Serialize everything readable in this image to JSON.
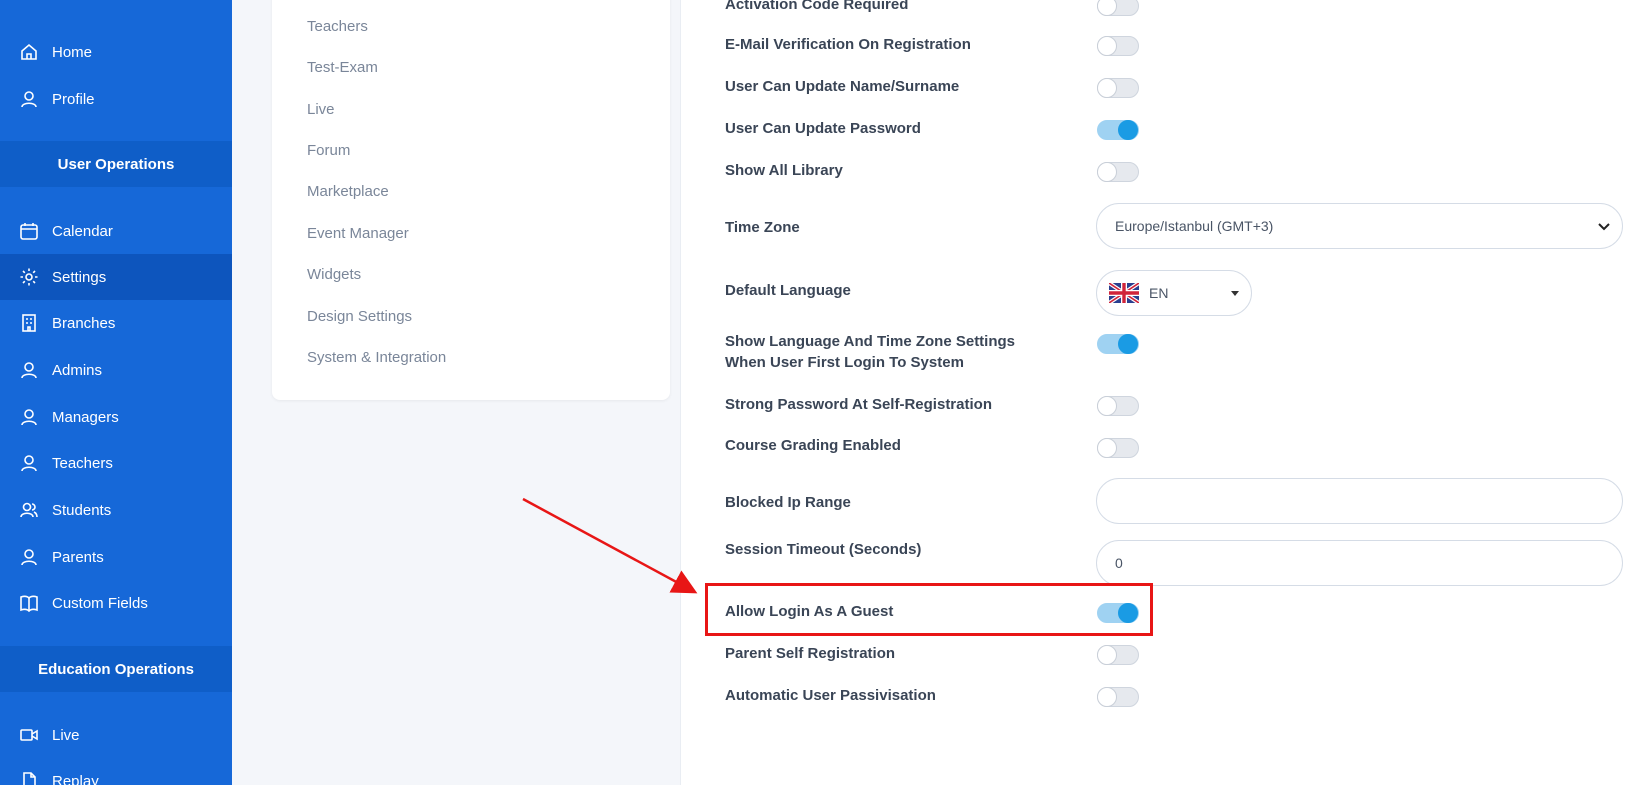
{
  "sidebar": {
    "items_top": [
      {
        "label": "Home",
        "icon": "home-icon"
      },
      {
        "label": "Profile",
        "icon": "user-icon"
      }
    ],
    "section_user": "User Operations",
    "items_user": [
      {
        "label": "Calendar",
        "icon": "calendar-icon"
      },
      {
        "label": "Settings",
        "icon": "gear-icon"
      },
      {
        "label": "Branches",
        "icon": "building-icon"
      },
      {
        "label": "Admins",
        "icon": "user-icon"
      },
      {
        "label": "Managers",
        "icon": "user-icon"
      },
      {
        "label": "Teachers",
        "icon": "user-icon"
      },
      {
        "label": "Students",
        "icon": "users-icon"
      },
      {
        "label": "Parents",
        "icon": "user-icon"
      },
      {
        "label": "Custom Fields",
        "icon": "book-icon"
      }
    ],
    "section_edu": "Education Operations",
    "items_edu": [
      {
        "label": "Live",
        "icon": "video-icon"
      },
      {
        "label": "Replay",
        "icon": "file-icon"
      }
    ],
    "active": "Settings"
  },
  "submenu": {
    "items": [
      "Teachers",
      "Test-Exam",
      "Live",
      "Forum",
      "Marketplace",
      "Event Manager",
      "Widgets",
      "Design Settings",
      "System & Integration"
    ]
  },
  "settings": {
    "activation_code": {
      "label": "Activation Code Required",
      "on": false
    },
    "email_verification": {
      "label": "E-Mail Verification On Registration",
      "on": false
    },
    "update_name": {
      "label": "User Can Update Name/Surname",
      "on": false
    },
    "update_password": {
      "label": "User Can Update Password",
      "on": true
    },
    "show_library": {
      "label": "Show All Library",
      "on": false
    },
    "time_zone": {
      "label": "Time Zone",
      "value": "Europe/Istanbul (GMT+3)"
    },
    "default_language": {
      "label": "Default Language",
      "value": "EN"
    },
    "show_lang_tz_line1": "Show Language And Time Zone Settings",
    "show_lang_tz_line2": "When User First Login To System",
    "show_lang_tz_on": true,
    "strong_password": {
      "label": "Strong Password At Self-Registration",
      "on": false
    },
    "course_grading": {
      "label": "Course Grading Enabled",
      "on": false
    },
    "blocked_ip": {
      "label": "Blocked Ip Range",
      "value": ""
    },
    "session_timeout": {
      "label": "Session Timeout (Seconds)",
      "value": "0"
    },
    "guest_login": {
      "label": "Allow Login As A Guest",
      "on": true
    },
    "parent_self_reg": {
      "label": "Parent Self Registration",
      "on": false
    },
    "auto_passivisation": {
      "label": "Automatic User Passivisation",
      "on": false
    }
  },
  "colors": {
    "sidebar": "#1668d8",
    "toggle_on": "#1a9be4",
    "highlight": "#e81616"
  }
}
